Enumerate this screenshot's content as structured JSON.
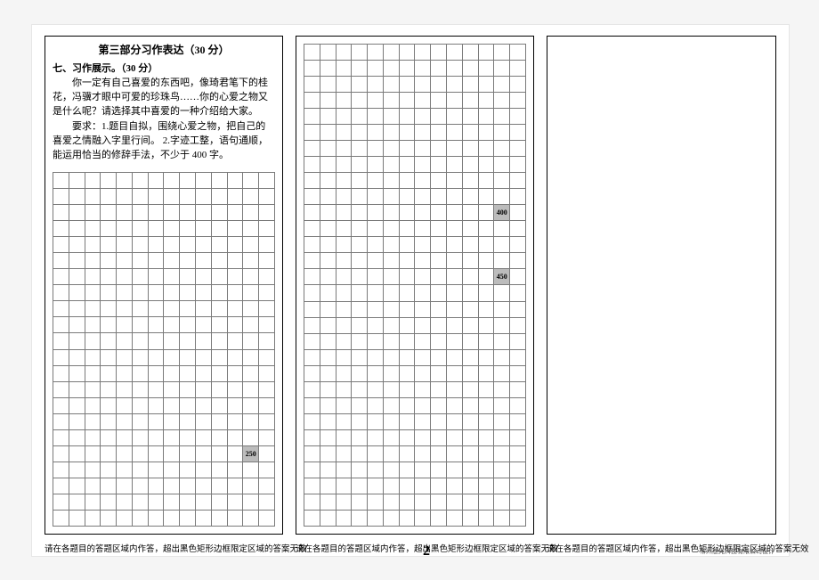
{
  "header": {
    "title": "第三部分习作表达（30 分）",
    "section_label": "七、习作展示。（30 分）",
    "prompt_p1": "你一定有自己喜爱的东西吧，像琦君笔下的桂花，冯骥才眼中可爱的珍珠鸟……你的心爱之物又是什么呢？请选择其中喜爱的一种介绍给大家。",
    "prompt_p2": "要求：1.题目自拟，围绕心爱之物，把自己的喜爱之情融入字里行间。 2.字迹工整，语句通顺，能运用恰当的修辞手法，不少于 400 字。"
  },
  "grid": {
    "cols": 14,
    "col1_rows": 22,
    "col2_rows": 30,
    "marks": {
      "col1": {
        "row": 17,
        "col": 12,
        "label": "250"
      },
      "col2_a": {
        "row": 10,
        "col": 12,
        "label": "400"
      },
      "col2_b": {
        "row": 14,
        "col": 12,
        "label": "450"
      }
    }
  },
  "footer": {
    "note": "请在各题目的答题区域内作答，超出黑色矩形边框限定区域的答案无效",
    "page": "2",
    "designer": "常州慧光科技有限公司设计"
  }
}
